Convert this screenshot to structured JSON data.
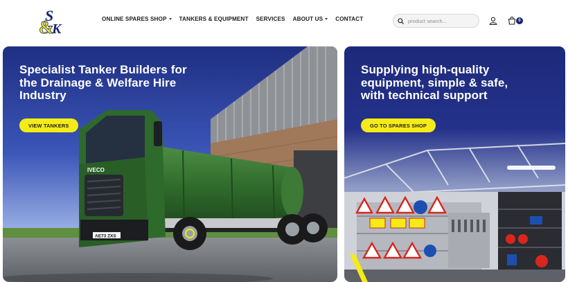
{
  "brand": {
    "logo_text": "S&K"
  },
  "nav": {
    "items": [
      {
        "label": "ONLINE SPARES SHOP",
        "has_dropdown": true
      },
      {
        "label": "TANKERS & EQUIPMENT",
        "has_dropdown": false
      },
      {
        "label": "SERVICES",
        "has_dropdown": false
      },
      {
        "label": "ABOUT US",
        "has_dropdown": true
      },
      {
        "label": "CONTACT",
        "has_dropdown": false
      }
    ]
  },
  "search": {
    "placeholder": "product search..."
  },
  "cart": {
    "count": "0"
  },
  "hero": {
    "left": {
      "title": "Specialist Tanker Builders for the Drainage & Welfare Hire Industry",
      "button": "VIEW TANKERS",
      "plate": "AE73 ZXS",
      "cab_badge": "IVECO"
    },
    "right": {
      "title": "Supplying high-quality equipment, simple & safe, with technical support",
      "button": "GO TO SPARES SHOP"
    }
  },
  "colors": {
    "navy": "#17246d",
    "yellow": "#f5ec17",
    "tanker_green": "#2f6b2c"
  },
  "icons": [
    "search-icon",
    "user-icon",
    "cart-icon",
    "caret-down-icon"
  ]
}
